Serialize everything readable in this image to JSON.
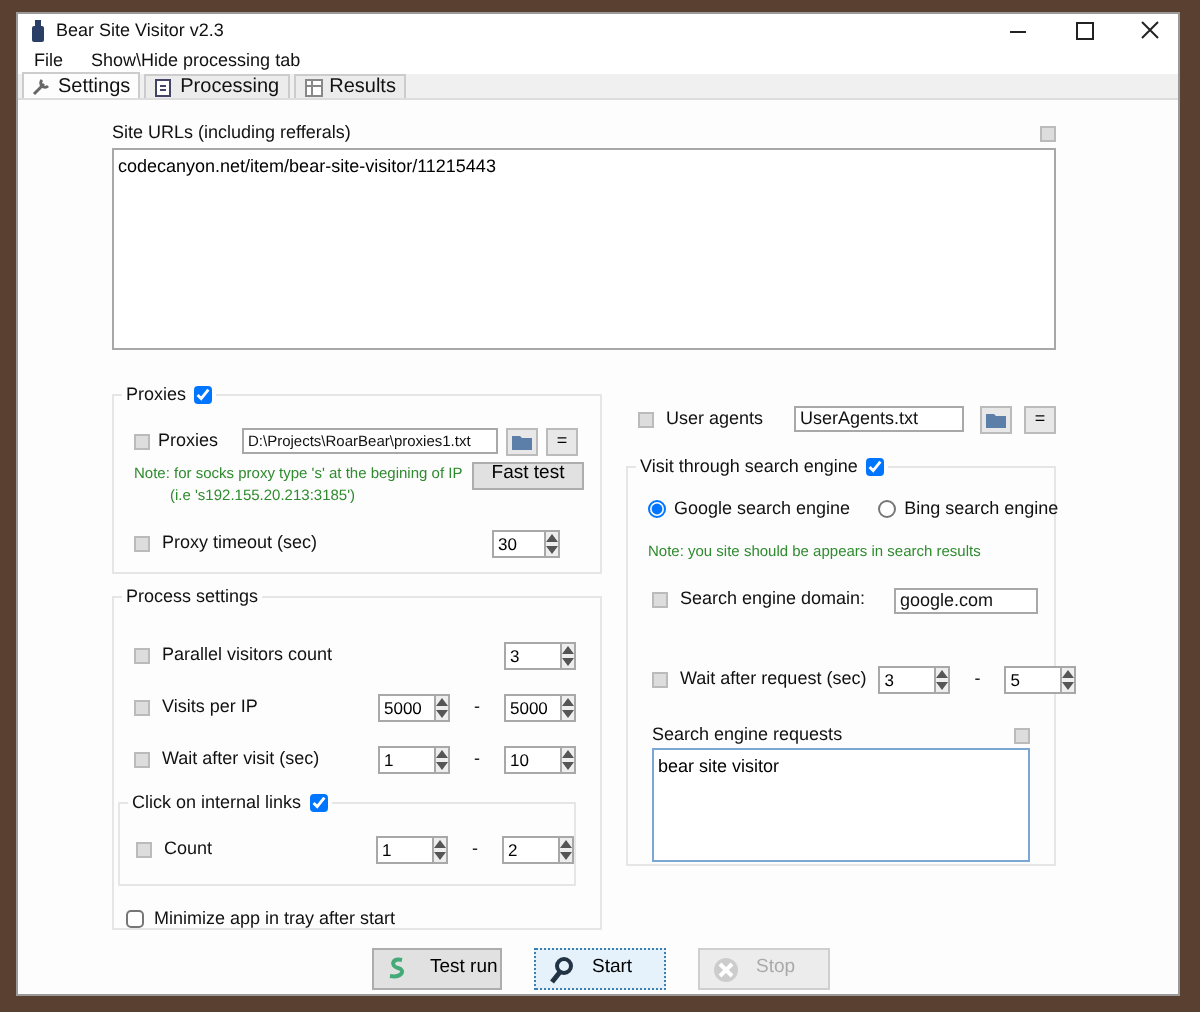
{
  "window": {
    "title": "Bear Site Visitor v2.3"
  },
  "menu": [
    "File",
    "Show\\Hide processing tab"
  ],
  "tabs": [
    {
      "label": "Settings",
      "selected": true,
      "kind": "wrench"
    },
    {
      "label": "Processing",
      "selected": false,
      "kind": "doc"
    },
    {
      "label": "Results",
      "selected": false,
      "kind": "table"
    }
  ],
  "site_urls": {
    "label": "Site URLs (including refferals)",
    "value": "codecanyon.net/item/bear-site-visitor/11215443"
  },
  "proxies": {
    "label": "Proxies",
    "checked": true,
    "file_label": "Proxies",
    "file_value": "D:\\Projects\\RoarBear\\proxies1.txt",
    "edit_button": "=",
    "note": [
      "Note: for socks proxy type 's' at the begining of IP",
      "(i.e 's192.155.20.213:3185')"
    ],
    "fast_test_button": "Fast test",
    "timeout_label": "Proxy timeout (sec)",
    "timeout_value": "30"
  },
  "process_settings": {
    "label": "Process settings",
    "parallel": {
      "label": "Parallel visitors count",
      "value": "3"
    },
    "visits_per_ip": {
      "label": "Visits per IP",
      "from": "5000",
      "separator": "-",
      "to": "5000"
    },
    "wait_after_visit": {
      "label": "Wait after visit (sec)",
      "from": "1",
      "separator": "-",
      "to": "10"
    },
    "internal_links": {
      "label": "Click on internal links",
      "checked": true
    },
    "count": {
      "label": "Count",
      "from": "1",
      "separator": "-",
      "to": "2"
    },
    "minimize": {
      "label": "Minimize app in tray after start",
      "checked": false
    }
  },
  "user_agents": {
    "label": "User agents",
    "value": "UserAgents.txt",
    "edit_button": "="
  },
  "search_engine": {
    "label": "Visit through search engine",
    "checked": true,
    "engines": [
      {
        "label": "Google search engine",
        "selected": true
      },
      {
        "label": "Bing search engine",
        "selected": false
      }
    ],
    "note": "Note: you site should be appears in search results",
    "domain_label": "Search engine domain:",
    "domain_value": "google.com",
    "wait": {
      "label": "Wait after request (sec)",
      "from": "3",
      "separator": "-",
      "to": "5"
    },
    "requests": {
      "label": "Search engine requests",
      "value": "bear site visitor"
    }
  },
  "buttons": [
    {
      "label": "Test run",
      "kind": "test",
      "disabled": false,
      "focused": false
    },
    {
      "label": "Start",
      "kind": "start",
      "disabled": false,
      "focused": true
    },
    {
      "label": "Stop",
      "kind": "stop",
      "disabled": true,
      "focused": false
    }
  ]
}
